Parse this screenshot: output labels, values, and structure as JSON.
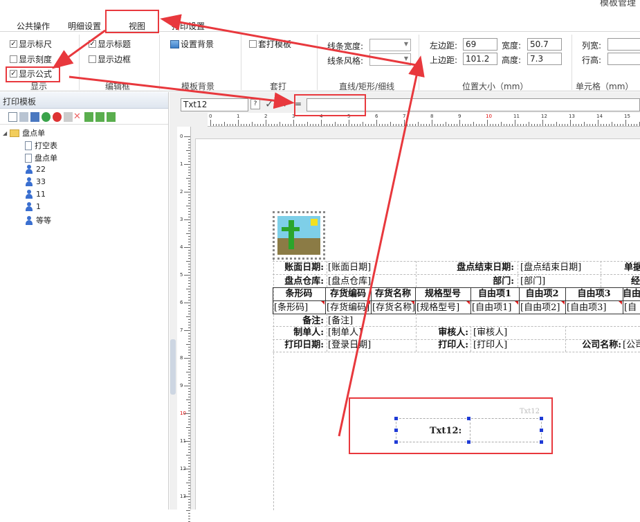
{
  "window": {
    "title_fragment": "模板管理"
  },
  "tabs": [
    "公共操作",
    "明细设置",
    "视图",
    "打印设置"
  ],
  "ribbon": {
    "display": {
      "items": [
        {
          "label": "显示标尺",
          "checked": true
        },
        {
          "label": "显示刻度",
          "checked": false
        },
        {
          "label": "显示公式",
          "checked": true
        }
      ],
      "group": "显示"
    },
    "editframe": {
      "items": [
        {
          "label": "显示标题",
          "checked": true
        },
        {
          "label": "显示边框",
          "checked": false
        }
      ],
      "group": "编辑框"
    },
    "background": {
      "button": "设置背景",
      "group": "模板背景"
    },
    "overlay": {
      "label": "套打模板",
      "checked": false,
      "group": "套打"
    },
    "lines": {
      "width_label": "线条宽度:",
      "style_label": "线条风格:",
      "group": "直线/矩形/细线"
    },
    "position": {
      "left_label": "左边距:",
      "left": "69",
      "width_label": "宽度:",
      "width": "50.7",
      "top_label": "上边距:",
      "top": "101.2",
      "height_label": "高度:",
      "height": "7.3",
      "group": "位置大小（mm）"
    },
    "cell": {
      "colw_label": "列宽:",
      "rowh_label": "行高:",
      "group": "单元格（mm）"
    }
  },
  "left_panel": {
    "title": "打印模板",
    "root": "盘点单",
    "children": [
      {
        "label": "打空表",
        "icon": "doc"
      },
      {
        "label": "盘点单",
        "icon": "doc"
      },
      {
        "label": "22",
        "icon": "user"
      },
      {
        "label": "33",
        "icon": "user"
      },
      {
        "label": "11",
        "icon": "user"
      },
      {
        "label": "1",
        "icon": "user"
      },
      {
        "label": "等等",
        "icon": "user"
      }
    ]
  },
  "formula": {
    "name": "Txt12",
    "eq": "=",
    "value": ""
  },
  "ruler": {
    "h": [
      "0",
      "1",
      "2",
      "3",
      "4",
      "5",
      "6",
      "7",
      "8",
      "9",
      "10",
      "11",
      "12",
      "13",
      "14",
      "15"
    ],
    "v": [
      "0",
      "1",
      "2",
      "3",
      "4",
      "5",
      "6",
      "7",
      "8",
      "9",
      "10",
      "11",
      "12",
      "13"
    ]
  },
  "report": {
    "r1": [
      "账面日期:",
      "[账面日期]",
      "盘点结束日期:",
      "[盘点结束日期]",
      "单据"
    ],
    "r2": [
      "盘点仓库:",
      "[盘点仓库]",
      "部门:",
      "[部门]",
      "经"
    ],
    "headers": [
      "条形码",
      "存货编码",
      "存货名称",
      "规格型号",
      "自由项1",
      "自由项2",
      "自由项3",
      "自由"
    ],
    "values": [
      "[条形码]",
      "[存货编码]",
      "[存货名称]",
      "[规格型号]",
      "[自由项1]",
      "[自由项2]",
      "[自由项3]",
      "[自"
    ],
    "r5": [
      "备注:",
      "[备注]"
    ],
    "r6": [
      "制单人:",
      "[制单人]",
      "审核人:",
      "[审核人]"
    ],
    "r7": [
      "打印日期:",
      "[登录日期]",
      "打印人:",
      "[打印人]",
      "公司名称:",
      "[公司"
    ],
    "selected": {
      "title": "Txt12",
      "label": "Txt12:"
    }
  }
}
